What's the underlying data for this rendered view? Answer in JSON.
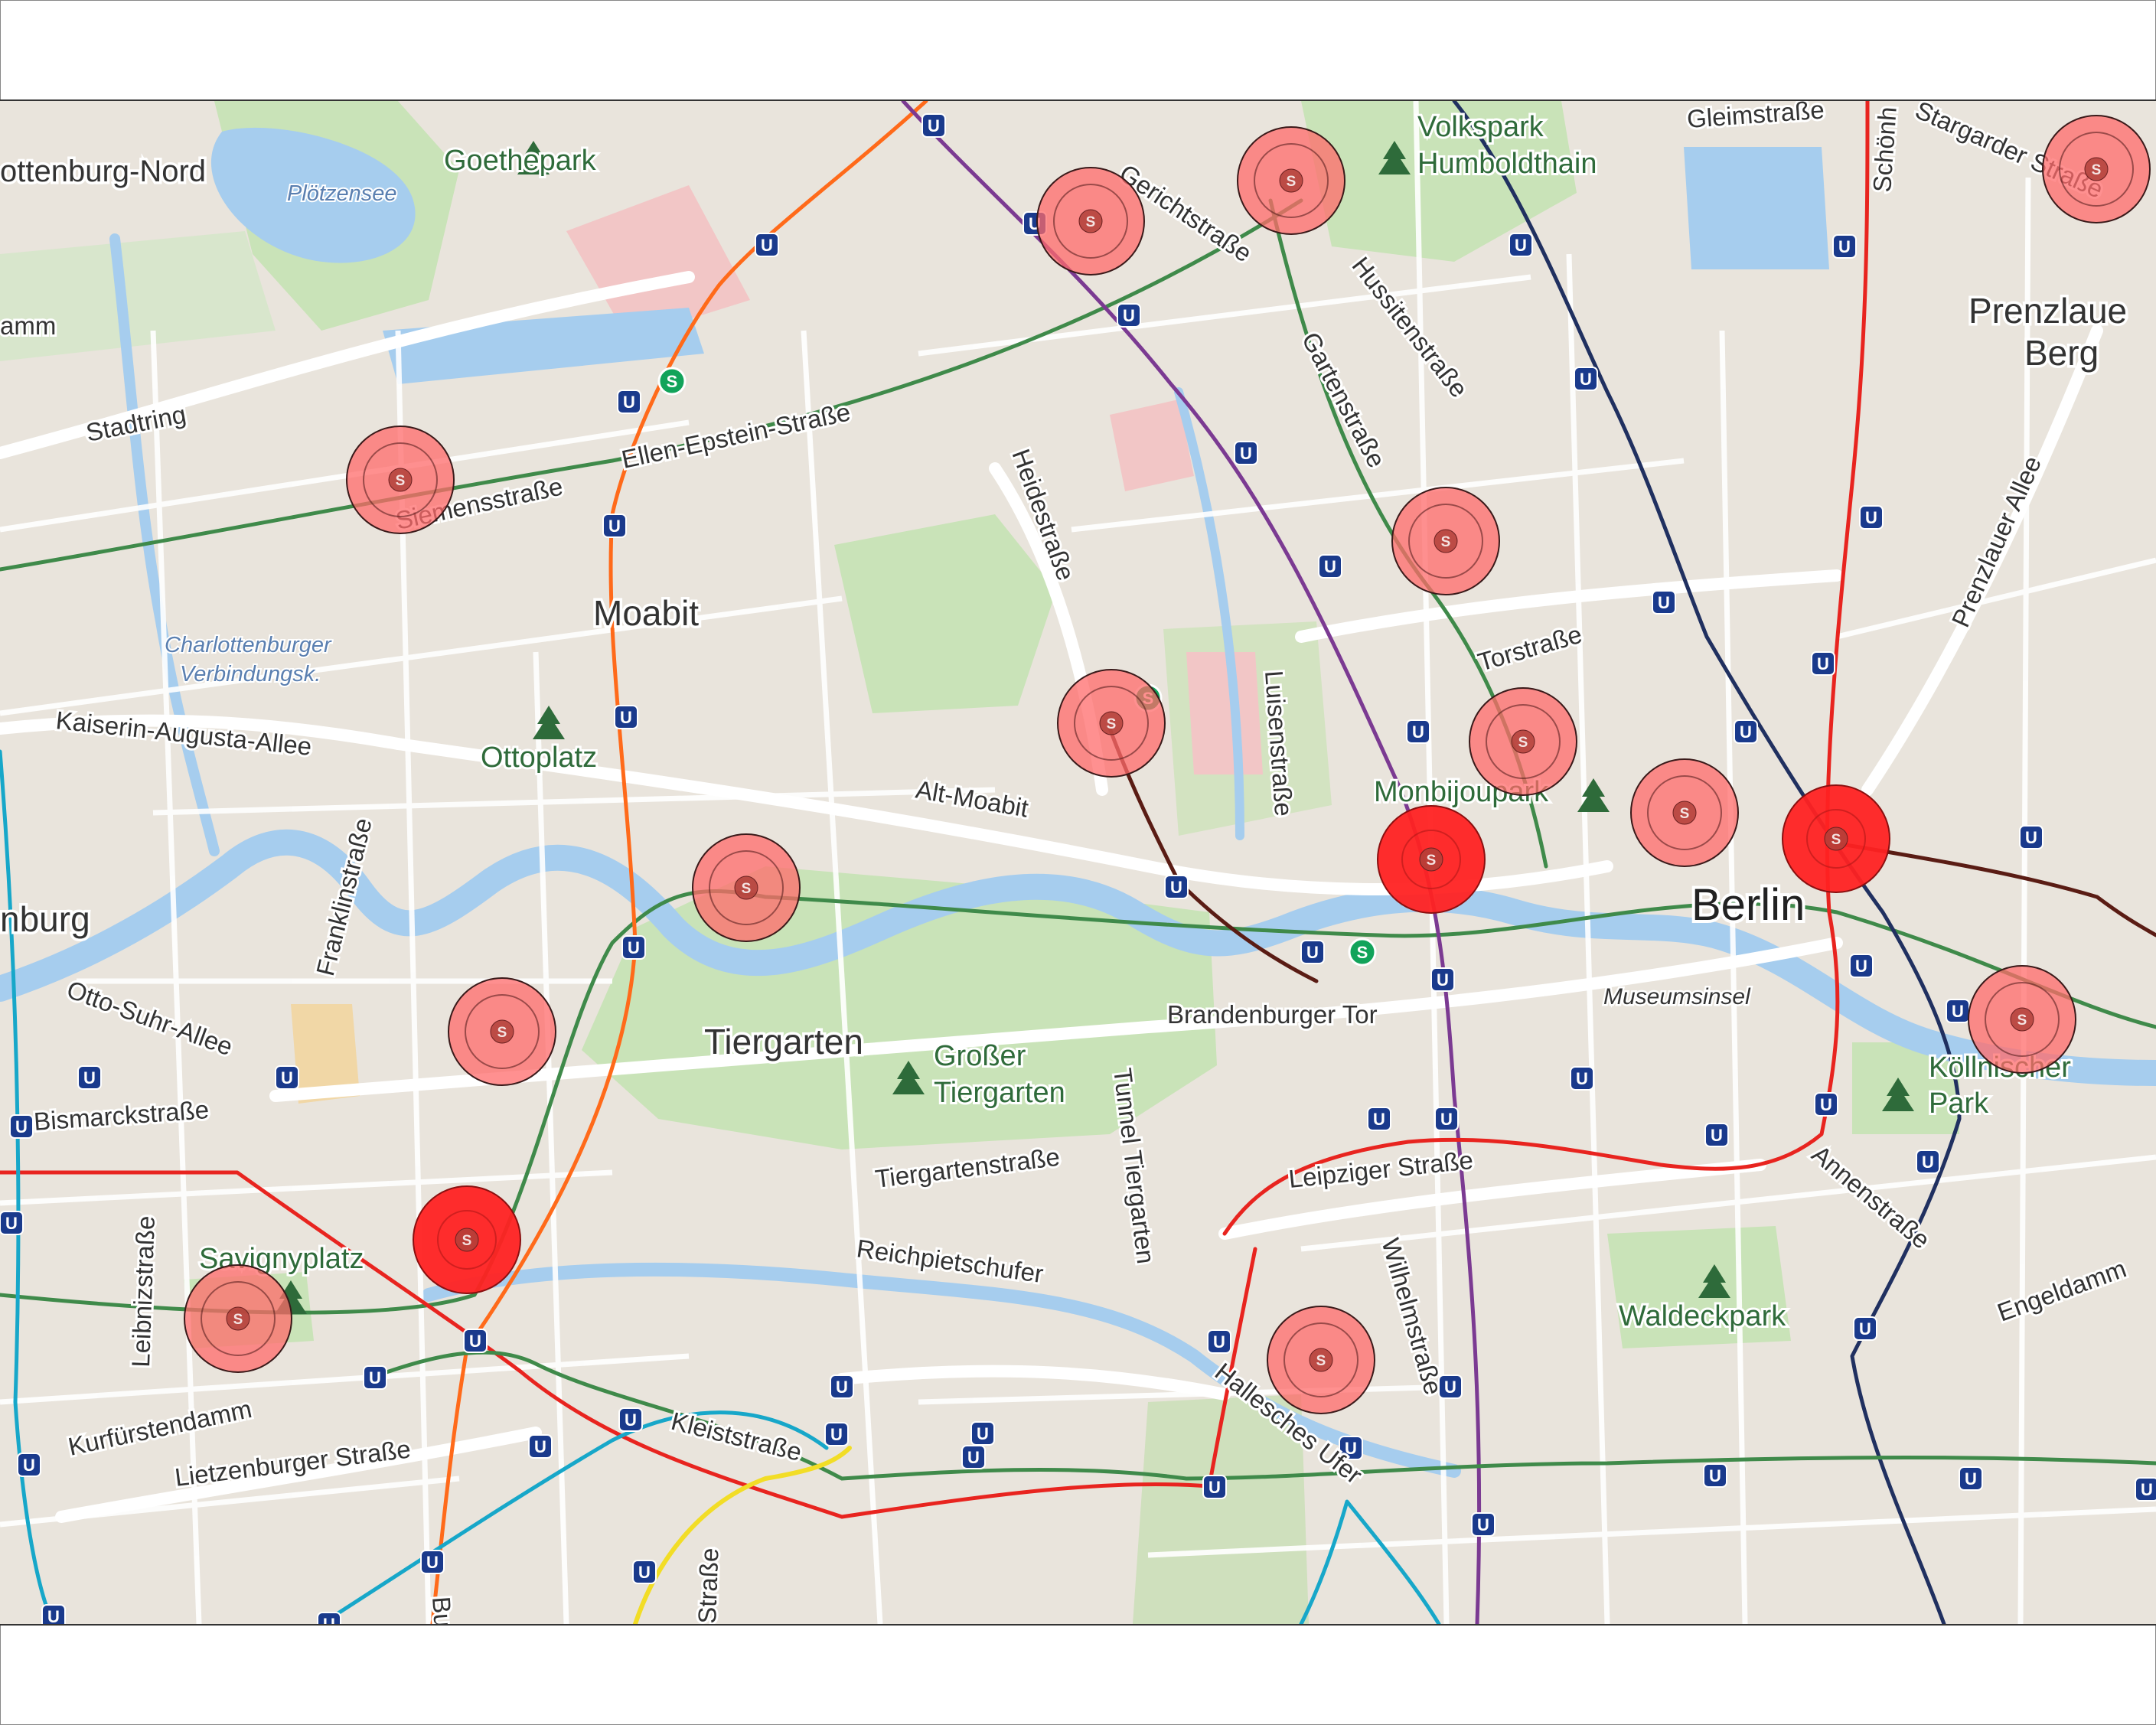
{
  "map": {
    "districts": [
      {
        "id": "charlottenburg-nord",
        "text": "ottenburg-Nord"
      },
      {
        "id": "moabit",
        "text": "Moabit"
      },
      {
        "id": "tiergarten",
        "text": "Tiergarten"
      },
      {
        "id": "prenzlauer-1",
        "text": "Prenzlaue"
      },
      {
        "id": "prenzlauer-2",
        "text": "Berg"
      },
      {
        "id": "burg",
        "text": "nburg"
      }
    ],
    "city_label": "Berlin",
    "parks": [
      {
        "id": "goethepark",
        "text": "Goethepark"
      },
      {
        "id": "volkspark-1",
        "text": "Volkspark"
      },
      {
        "id": "volkspark-2",
        "text": "Humboldthain"
      },
      {
        "id": "ottoplatz",
        "text": "Ottoplatz"
      },
      {
        "id": "monbijoupark",
        "text": "Monbijoupark"
      },
      {
        "id": "grosser-1",
        "text": "Großer"
      },
      {
        "id": "grosser-2",
        "text": "Tiergarten"
      },
      {
        "id": "savignyplatz",
        "text": "Savignyplatz"
      },
      {
        "id": "waldeckpark",
        "text": "Waldeckpark"
      },
      {
        "id": "koellnischer-1",
        "text": "Köllnischer"
      },
      {
        "id": "koellnischer-2",
        "text": "Park"
      }
    ],
    "waters": [
      {
        "id": "ploetzensee",
        "text": "Plötzensee"
      },
      {
        "id": "charlottenburger-1",
        "text": "Charlottenburger"
      },
      {
        "id": "charlottenburger-2",
        "text": "Verbindungsk."
      }
    ],
    "streets": [
      {
        "id": "stadtring",
        "text": "Stadtring"
      },
      {
        "id": "damm",
        "text": "amm"
      },
      {
        "id": "ellen-epstein",
        "text": "Ellen-Epstein-Straße"
      },
      {
        "id": "siemensstrasse",
        "text": "Siemensstraße"
      },
      {
        "id": "gerichtstrasse",
        "text": "Gerichtstraße"
      },
      {
        "id": "gleimstrasse",
        "text": "Gleimstraße"
      },
      {
        "id": "schoenhauser",
        "text": "Schönh"
      },
      {
        "id": "stargarder",
        "text": "Stargarder Straße"
      },
      {
        "id": "hussitenstrasse",
        "text": "Hussitenstraße"
      },
      {
        "id": "gartenstrasse",
        "text": "Gartenstraße"
      },
      {
        "id": "heidestrasse",
        "text": "Heidestraße"
      },
      {
        "id": "torstrasse",
        "text": "Torstraße"
      },
      {
        "id": "prenzlauer-allee",
        "text": "Prenzlauer Allee"
      },
      {
        "id": "kaiserin-augusta",
        "text": "Kaiserin-Augusta-Allee"
      },
      {
        "id": "alt-moabit",
        "text": "Alt-Moabit"
      },
      {
        "id": "luisenstrasse",
        "text": "Luisenstraße"
      },
      {
        "id": "franklinstrasse",
        "text": "Franklinstraße"
      },
      {
        "id": "otto-suhr",
        "text": "Otto-Suhr-Allee"
      },
      {
        "id": "bismarckstrasse",
        "text": "Bismarckstraße"
      },
      {
        "id": "brandenburger-tor",
        "text": "Brandenburger Tor"
      },
      {
        "id": "tunnel-tiergarten",
        "text": "Tunnel Tiergarten"
      },
      {
        "id": "tiergartenstrasse",
        "text": "Tiergartenstraße"
      },
      {
        "id": "leipziger-strasse",
        "text": "Leipziger Straße"
      },
      {
        "id": "wilhelmstrasse",
        "text": "Wilhelmstraße"
      },
      {
        "id": "annenstrasse",
        "text": "Annenstraße"
      },
      {
        "id": "engeldamm",
        "text": "Engeldamm"
      },
      {
        "id": "leibnizstrasse",
        "text": "Leibnizstraße"
      },
      {
        "id": "reichpietschufer",
        "text": "Reichpietschufer"
      },
      {
        "id": "kurfuerstendamm",
        "text": "Kurfürstendamm"
      },
      {
        "id": "lietzenburger",
        "text": "Lietzenburger Straße"
      },
      {
        "id": "kleiststrasse",
        "text": "Kleiststraße"
      },
      {
        "id": "hallesches-ufer",
        "text": "Hallesches Ufer"
      },
      {
        "id": "strasse-bottom",
        "text": "Straße"
      },
      {
        "id": "bu-bottom",
        "text": "Bu"
      }
    ],
    "museumsinsel": "Museumsinsel",
    "station_glyph": "S",
    "ubahn_glyph": "U",
    "colors": {
      "land": "#e9e4dc",
      "block": "#dcd4c9",
      "park": "#c9e3b8",
      "water": "#a6cdee",
      "road": "#ffffff",
      "marker_fill": "#ff6b6b",
      "marker_big": "#ff2222",
      "u_badge": "#1a3a8c",
      "s_badge": "#12a35a",
      "line_orange": "#ff6a1a",
      "line_purple": "#7b3a92",
      "line_navy": "#203060",
      "line_red": "#e8241f",
      "line_green": "#3f8a4a",
      "line_cyan": "#17a7c9",
      "line_brown": "#5a1c14",
      "line_yellow": "#f2dd26"
    }
  }
}
